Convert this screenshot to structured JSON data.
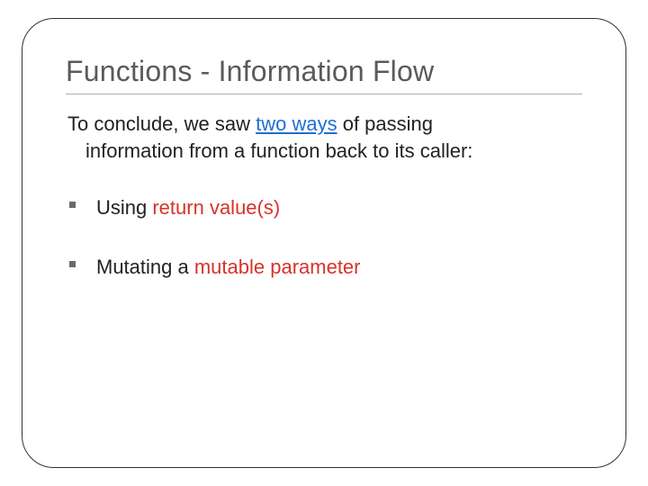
{
  "title": "Functions -  Information Flow",
  "intro": {
    "line1_prefix": "To conclude, we saw ",
    "highlight": "two ways",
    "line1_suffix": " of passing",
    "line2": "information from a function back to its caller:"
  },
  "bullets": [
    {
      "plain_before": "Using ",
      "highlight": "return value(s)",
      "plain_after": ""
    },
    {
      "plain_before": "Mutating a ",
      "highlight": "mutable parameter",
      "plain_after": ""
    }
  ]
}
